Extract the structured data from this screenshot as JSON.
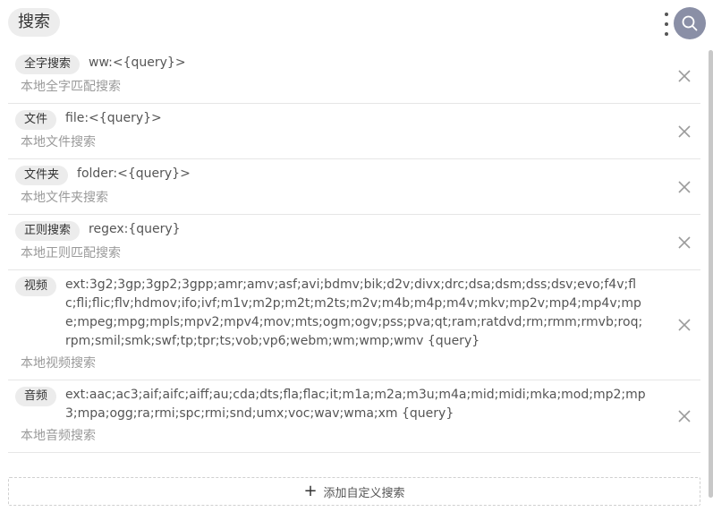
{
  "header": {
    "title": "搜索",
    "more_icon": "more-vertical-icon",
    "search_icon": "search-icon",
    "search_color": "#8a8fa6"
  },
  "rules": [
    {
      "tag": "全字搜索",
      "pattern": "ww:<{query}>",
      "description": "本地全字匹配搜索"
    },
    {
      "tag": "文件",
      "pattern": "file:<{query}>",
      "description": "本地文件搜索"
    },
    {
      "tag": "文件夹",
      "pattern": "folder:<{query}>",
      "description": "本地文件夹搜索"
    },
    {
      "tag": "正则搜索",
      "pattern": "regex:{query}",
      "description": "本地正则匹配搜索"
    },
    {
      "tag": "视频",
      "pattern": "ext:3g2;3gp;3gp2;3gpp;amr;amv;asf;avi;bdmv;bik;d2v;divx;drc;dsa;dsm;dss;dsv;evo;f4v;flc;fli;flic;flv;hdmov;ifo;ivf;m1v;m2p;m2t;m2ts;m2v;m4b;m4p;m4v;mkv;mp2v;mp4;mp4v;mpe;mpeg;mpg;mpls;mpv2;mpv4;mov;mts;ogm;ogv;pss;pva;qt;ram;ratdvd;rm;rmm;rmvb;roq;rpm;smil;smk;swf;tp;tpr;ts;vob;vp6;webm;wm;wmp;wmv {query}",
      "description": "本地视频搜索"
    },
    {
      "tag": "音频",
      "pattern": "ext:aac;ac3;aif;aifc;aiff;au;cda;dts;fla;flac;it;m1a;m2a;m3u;m4a;mid;midi;mka;mod;mp2;mp3;mpa;ogg;ra;rmi;spc;rmi;snd;umx;voc;wav;wma;xm {query}",
      "description": "本地音频搜索"
    }
  ],
  "remove_icon": "close-icon",
  "add_button": {
    "icon": "plus-icon",
    "label": "添加自定义搜索"
  }
}
